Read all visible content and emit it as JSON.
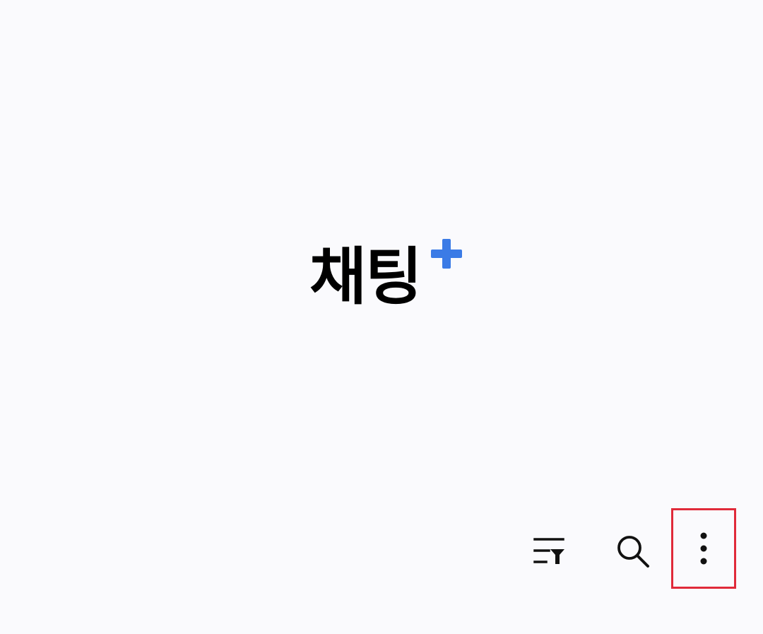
{
  "app": {
    "logo_text": "채팅",
    "logo_accent": "+",
    "accent_color": "#3b7be6",
    "background_color": "#fafafd"
  },
  "toolbar": {
    "buttons": [
      {
        "name": "filter-button",
        "icon": "list-filter-icon"
      },
      {
        "name": "search-button",
        "icon": "search-icon"
      },
      {
        "name": "more-options-button",
        "icon": "vertical-dots-icon",
        "highlighted": true,
        "highlight_color": "#e02a3a"
      }
    ]
  }
}
